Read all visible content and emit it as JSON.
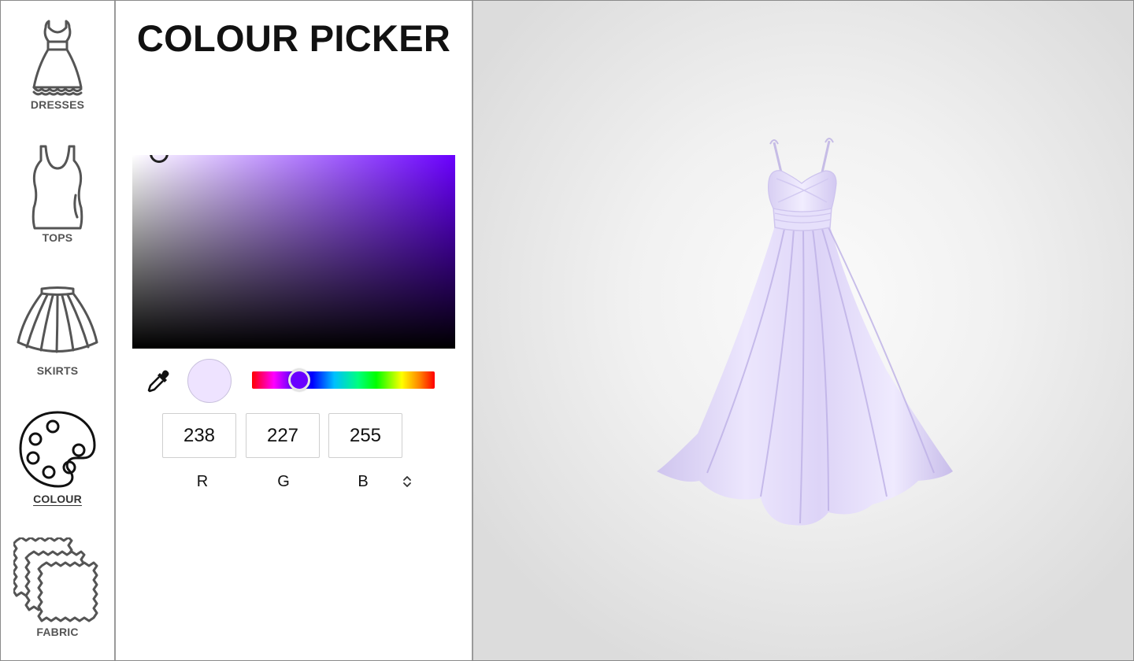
{
  "sidebar": {
    "items": [
      {
        "label": "DRESSES",
        "icon": "dress-icon"
      },
      {
        "label": "TOPS",
        "icon": "tank-top-icon"
      },
      {
        "label": "SKIRTS",
        "icon": "skirt-icon"
      },
      {
        "label": "COLOUR",
        "icon": "palette-icon",
        "active": true
      },
      {
        "label": "FABRIC",
        "icon": "fabric-swatches-icon"
      }
    ]
  },
  "panel": {
    "title": "COLOUR PICKER",
    "hue_color": "#6a00ff",
    "selected_color": "#eee3ff",
    "rgb": {
      "r": "238",
      "g": "227",
      "b": "255"
    },
    "labels": {
      "r": "R",
      "g": "G",
      "b": "B"
    },
    "eyedropper_icon": "eyedropper-icon",
    "mode_toggle_icon": "chevron-up-down-icon"
  },
  "viewer": {
    "model": "dress-3d-preview",
    "dress_color": "#e0d8f7"
  }
}
